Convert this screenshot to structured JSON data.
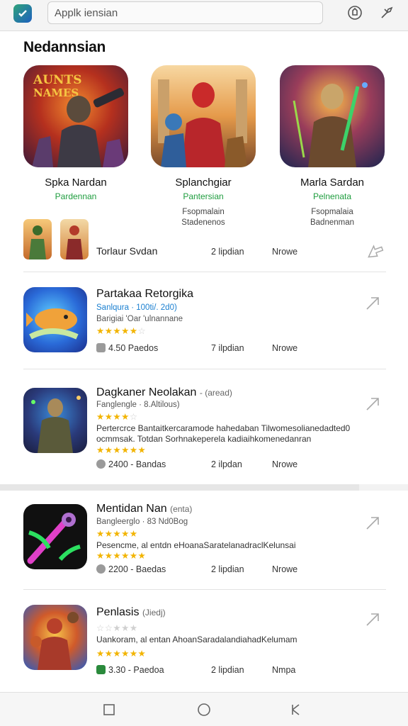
{
  "header": {
    "search_placeholder": "Applk iensian"
  },
  "section": {
    "title": "Nedannsian"
  },
  "featured": [
    {
      "name": "Spka Nardan",
      "category": "Pardennan",
      "meta1": "",
      "meta2": ""
    },
    {
      "name": "Splanchgiar",
      "category": "Pantersian",
      "meta1": "Fsopmalain",
      "meta2": "Stadenenos"
    },
    {
      "name": "Marla Sardan",
      "category": "Pelnenata",
      "meta1": "Fsopmalaia",
      "meta2": "Badnenman"
    }
  ],
  "featured_logo_text": "AUNTS NAMES",
  "summary_row": {
    "label": "Torlaur Svdan",
    "col1": "2 lipdian",
    "col2": "Nrowe"
  },
  "items": [
    {
      "title": "Partakaa Retorgika",
      "tag": "",
      "sub1": "Sanlqura · 100ti/. 2d0)",
      "sub2": "Barigiai 'Oar 'ulnannane",
      "rating": 4.5,
      "desc": "",
      "stat": "4.50 Paedos",
      "col1": "7 ilpdian",
      "col2": "Nrowe"
    },
    {
      "title": "Dagkaner Neolakan",
      "tag": "- (aread)",
      "sub1": "Fanglengle · 8.Altilous)",
      "rating": 3.5,
      "desc": "Pertercrce Bantaitkercaramode hahedaban Tilwomesolianedadted0 ocmmsak. Totdan Sorhnakeperela kadiaihkomenedanran",
      "stat": "2400 - Bandas",
      "col1": "2 ilpdan",
      "col2": "Nrowe"
    },
    {
      "title": "Mentidan Nan",
      "tag": "(enta)",
      "sub1": "Bangleerglo · 83 Nd0Bog",
      "rating": 5,
      "desc": "Pesencme, al entdn eHoanaSaratelanadraclKelunsai",
      "stat": "2200 - Baedas",
      "col1": "2 lipdian",
      "col2": "Nrowe"
    },
    {
      "title": "Penlasis",
      "tag": "(Jiedj)",
      "sub1": "",
      "rating": 0,
      "desc": "Uankoram, al entan AhoanSaradalandiahadKelumam",
      "stat": "3.30 - Paedoa",
      "col1": "2 lipdian",
      "col2": "Nmpa"
    }
  ],
  "colors": {
    "accent_green": "#1f9d3f",
    "star": "#f2b400",
    "link_blue": "#1a7fd0"
  },
  "icons": [
    "app-logo-icon",
    "shield-icon",
    "settings-tool-icon",
    "share-arrow-icon",
    "square-nav-icon",
    "circle-nav-icon",
    "back-nav-icon"
  ]
}
